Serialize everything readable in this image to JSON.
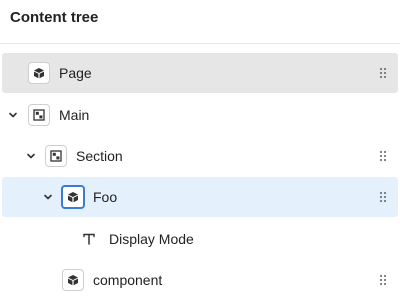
{
  "panel": {
    "title": "Content tree"
  },
  "tree": {
    "page_label": "Page",
    "main_label": "Main",
    "section_label": "Section",
    "foo_label": "Foo",
    "display_mode_label": "Display Mode",
    "component_label": "component"
  },
  "icons": {
    "page": "cube-icon",
    "main": "layout-icon",
    "section": "layout-icon",
    "foo": "cube-icon",
    "display_mode": "text-icon",
    "component": "cube-icon",
    "expand": "chevron-down-icon",
    "handle": "drag-handle-icon"
  },
  "colors": {
    "selected_row": "#e6e6e6",
    "highlighted_row": "#e4f0fb",
    "focus_border": "#3a7bd5"
  }
}
